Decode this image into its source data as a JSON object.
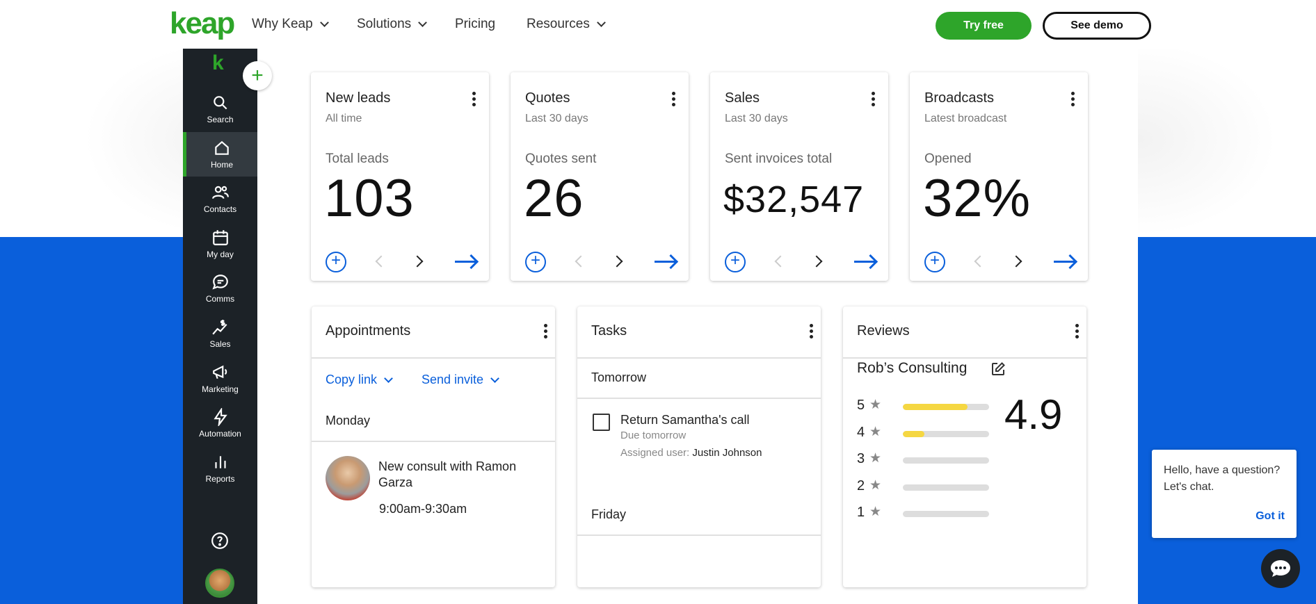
{
  "topnav": {
    "logo": "keap",
    "items": [
      "Why Keap",
      "Solutions",
      "Pricing",
      "Resources"
    ],
    "try_label": "Try free",
    "demo_label": "See demo"
  },
  "sidebar": {
    "logo": "k",
    "items": [
      "Search",
      "Home",
      "Contacts",
      "My day",
      "Comms",
      "Sales",
      "Marketing",
      "Automation",
      "Reports"
    ],
    "active": "Home"
  },
  "stats": [
    {
      "title": "New leads",
      "sub": "All time",
      "label": "Total leads",
      "value": "103"
    },
    {
      "title": "Quotes",
      "sub": "Last 30 days",
      "label": "Quotes sent",
      "value": "26"
    },
    {
      "title": "Sales",
      "sub": "Last 30 days",
      "label": "Sent invoices total",
      "value": "$32,547"
    },
    {
      "title": "Broadcasts",
      "sub": "Latest broadcast",
      "label": "Opened",
      "value": "32%"
    }
  ],
  "appointments": {
    "title": "Appointments",
    "copy_link": "Copy link",
    "send_invite": "Send invite",
    "day": "Monday",
    "item_title": "New consult with Ramon Garza",
    "item_time": "9:00am-9:30am"
  },
  "tasks": {
    "title": "Tasks",
    "day1": "Tomorrow",
    "task_title": "Return Samantha's call",
    "task_due": "Due tomorrow",
    "assigned_label": "Assigned user:",
    "assigned_name": "Justin Johnson",
    "day2": "Friday"
  },
  "reviews": {
    "title": "Reviews",
    "business": "Rob’s Consulting",
    "average": "4.9",
    "ratings": [
      {
        "stars": "5",
        "share": 0.75
      },
      {
        "stars": "4",
        "share": 0.25
      },
      {
        "stars": "3",
        "share": 0
      },
      {
        "stars": "2",
        "share": 0
      },
      {
        "stars": "1",
        "share": 0
      }
    ]
  },
  "chat": {
    "message": "Hello, have a question? Let's chat.",
    "got_it": "Got it"
  },
  "colors": {
    "brand_green": "#2ea52a",
    "accent_blue": "#0a5fdb",
    "sidebar": "#1c2227",
    "rating_fill": "#f5d742"
  }
}
